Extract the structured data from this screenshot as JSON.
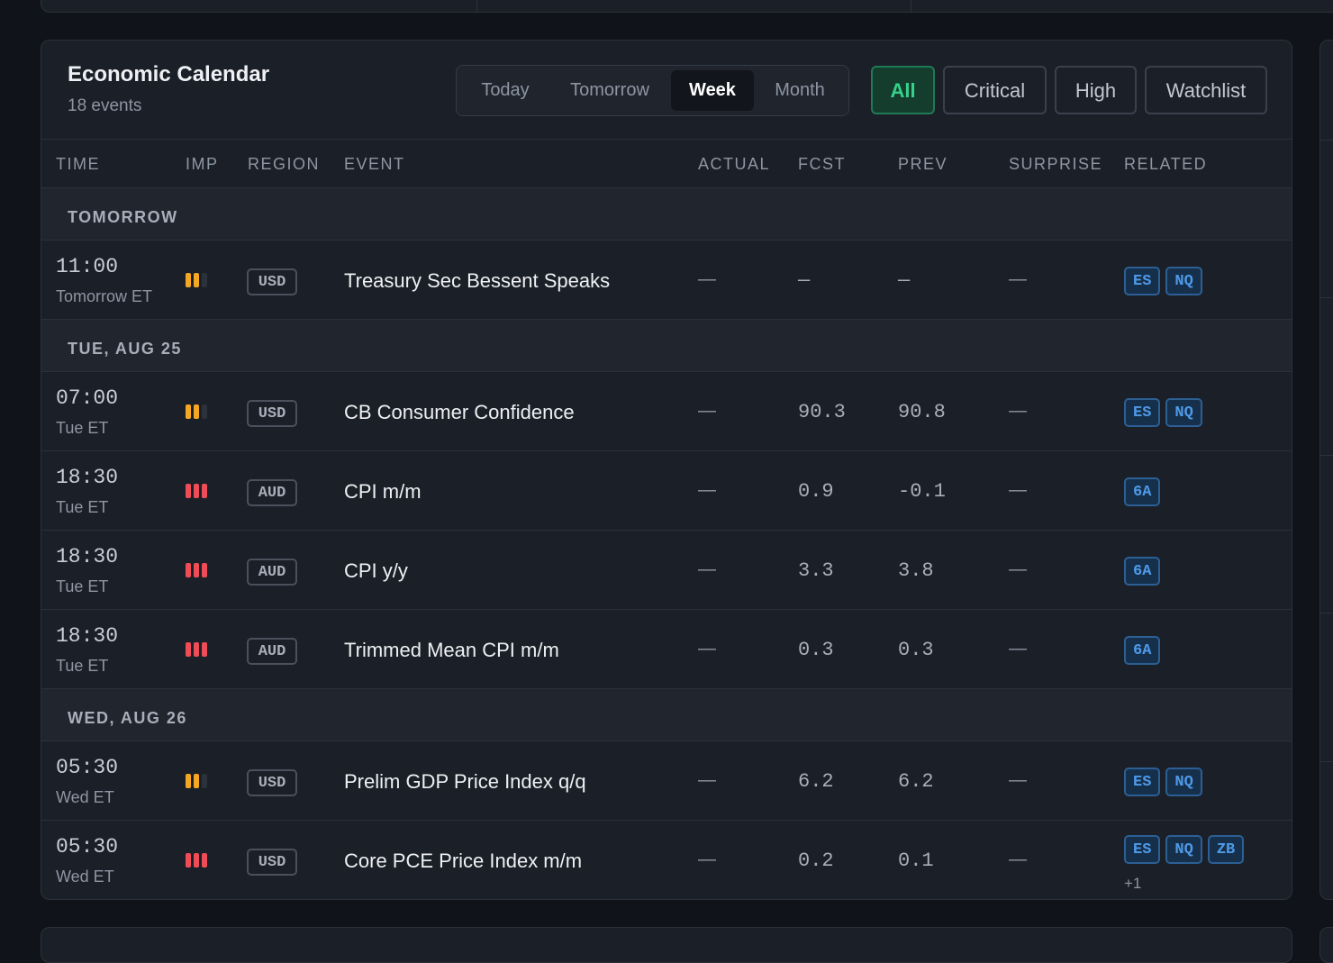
{
  "calendar": {
    "title": "Economic Calendar",
    "count": "18 events",
    "ranges": [
      "Today",
      "Tomorrow",
      "Week",
      "Month"
    ],
    "active_range": "Week",
    "filters": [
      "All",
      "Critical",
      "High",
      "Watchlist"
    ],
    "active_filter": "All",
    "columns": {
      "time": "TIME",
      "imp": "IMP",
      "region": "REGION",
      "event": "EVENT",
      "actual": "ACTUAL",
      "fcst": "FCST",
      "prev": "PREV",
      "surprise": "SURPRISE",
      "related": "RELATED"
    },
    "groups": [
      {
        "label": "TOMORROW",
        "rows": [
          {
            "time": "11:00",
            "sub": "Tomorrow ET",
            "importance": 2,
            "region": "USD",
            "event": "Treasury Sec Bessent Speaks",
            "actual": "—",
            "fcst": "—",
            "prev": "—",
            "surprise": "—",
            "related": [
              "ES",
              "NQ"
            ],
            "more": ""
          }
        ]
      },
      {
        "label": "TUE, AUG 25",
        "rows": [
          {
            "time": "07:00",
            "sub": "Tue ET",
            "importance": 2,
            "region": "USD",
            "event": "CB Consumer Confidence",
            "actual": "—",
            "fcst": "90.3",
            "prev": "90.8",
            "surprise": "—",
            "related": [
              "ES",
              "NQ"
            ],
            "more": ""
          },
          {
            "time": "18:30",
            "sub": "Tue ET",
            "importance": 3,
            "region": "AUD",
            "event": "CPI m/m",
            "actual": "—",
            "fcst": "0.9",
            "prev": "-0.1",
            "surprise": "—",
            "related": [
              "6A"
            ],
            "more": ""
          },
          {
            "time": "18:30",
            "sub": "Tue ET",
            "importance": 3,
            "region": "AUD",
            "event": "CPI y/y",
            "actual": "—",
            "fcst": "3.3",
            "prev": "3.8",
            "surprise": "—",
            "related": [
              "6A"
            ],
            "more": ""
          },
          {
            "time": "18:30",
            "sub": "Tue ET",
            "importance": 3,
            "region": "AUD",
            "event": "Trimmed Mean CPI m/m",
            "actual": "—",
            "fcst": "0.3",
            "prev": "0.3",
            "surprise": "—",
            "related": [
              "6A"
            ],
            "more": ""
          }
        ]
      },
      {
        "label": "WED, AUG 26",
        "rows": [
          {
            "time": "05:30",
            "sub": "Wed ET",
            "importance": 2,
            "region": "USD",
            "event": "Prelim GDP Price Index q/q",
            "actual": "—",
            "fcst": "6.2",
            "prev": "6.2",
            "surprise": "—",
            "related": [
              "ES",
              "NQ"
            ],
            "more": ""
          },
          {
            "time": "05:30",
            "sub": "Wed ET",
            "importance": 3,
            "region": "USD",
            "event": "Core PCE Price Index m/m",
            "actual": "—",
            "fcst": "0.2",
            "prev": "0.1",
            "surprise": "—",
            "related": [
              "ES",
              "NQ",
              "ZB"
            ],
            "more": "+1"
          }
        ]
      }
    ],
    "colors": {
      "importance_medium": "#f5a623",
      "importance_high": "#ee4d57",
      "accent_green": "#36d28a",
      "tag_blue": "#4f9ae8"
    }
  }
}
